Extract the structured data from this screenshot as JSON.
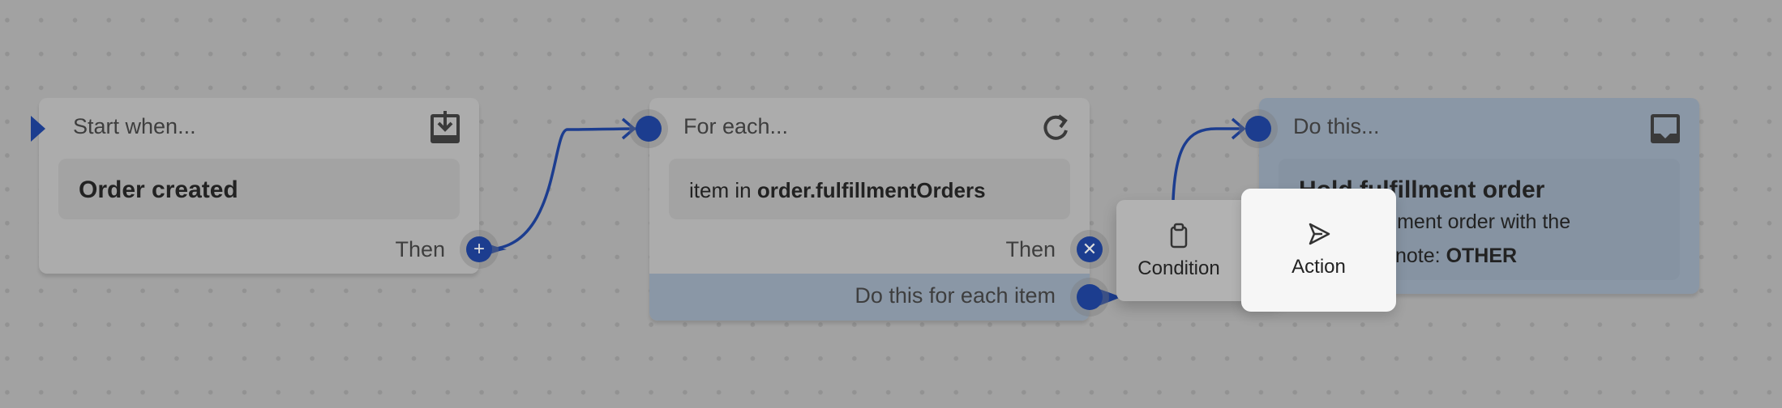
{
  "colors": {
    "accent": "#1c3d8f",
    "highlight": "#cfe2f6"
  },
  "start_card": {
    "title": "Start when...",
    "icon": "inbox-download-icon",
    "trigger": "Order created",
    "then_label": "Then",
    "port_icon": "plus-icon"
  },
  "foreach_card": {
    "title": "For each...",
    "icon": "loop-arrow-icon",
    "expr_prefix": "item in",
    "expr_value": "order.fulfillmentOrders",
    "then_label": "Then",
    "port_icon": "close-icon",
    "each_label": "Do this for each item"
  },
  "action_card": {
    "title": "Do this...",
    "icon": "inbox-icon",
    "action_title": "Hold fulfillment order",
    "desc_line1": "llment order with the",
    "desc_line2_prefix": "note:",
    "desc_line2_value": "OTHER"
  },
  "step_picker": {
    "items": [
      {
        "label": "Condition",
        "icon": "clipboard-icon"
      },
      {
        "label": "Action",
        "icon": "send-icon"
      }
    ]
  }
}
